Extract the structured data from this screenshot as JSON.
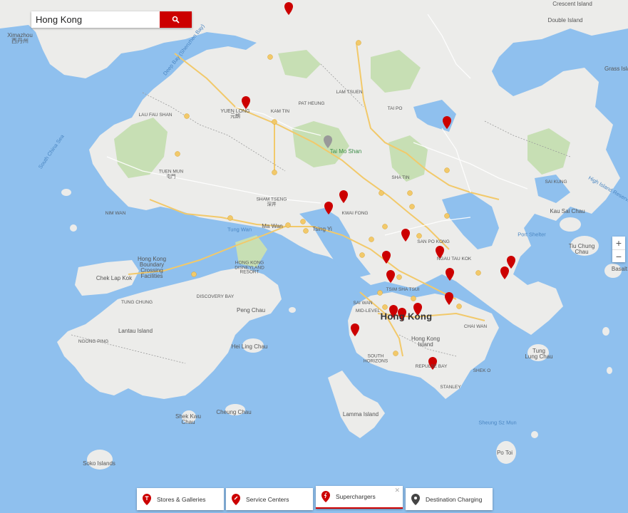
{
  "search": {
    "value": "Hong Kong"
  },
  "map": {
    "city_label": "Hong Kong",
    "labels": {
      "ximazhou": "Ximazhou\n西丹州",
      "crescent_island": "Crescent Island",
      "double_island": "Double Island",
      "grass_island": "Grass Isla",
      "yuen_long": "YUEN LONG\n元朗",
      "tai_mo_shan": "Tai Mo Shan",
      "lau_fau_shan": "LAU FAU SHAN",
      "tuen_mun": "TUEN MUN\n屯門",
      "tung_wan": "Tung Wan",
      "ma_wan": "Ma Wan",
      "tsing_yi": "Tsing Yi",
      "kwai_fong": "KWAI FONG",
      "sham_tseng": "SHAM TSENG\n深井",
      "hk_boundary": "Hong Kong\nBoundary\nCrossing\nFacilities",
      "chek_lap_kok": "Chek Lap Kok",
      "lantau_island": "Lantau Island",
      "peng_chau": "Peng Chau",
      "hei_ling_chau": "Hei Ling Chau",
      "cheung_chau": "Cheung Chau",
      "shek_kwu_chau": "Shek Kwu\nChau",
      "soko_islands": "Soko Islands",
      "lamma_island": "Lamma Island",
      "hong_kong_island": "Hong Kong\nIsland",
      "tung_lung_chau": "Tung\nLung Chau",
      "po_toi": "Po Toi",
      "kau_sai_chau": "Kau Sai Chau",
      "port_shelter": "Port Shelter",
      "tiu_chung_chau": "Tiu Chung\nChau",
      "basalt": "Basalt",
      "sai_kung": "SAI KUNG",
      "discovery_bay": "DISCOVERY BAY",
      "disneyland": "HONG KONG\nDISNEYLAND\nRESORT",
      "tung_chung": "TUNG CHUNG",
      "sheung_sz_mun": "Sheung Sz Mun",
      "south_china_sea": "South China Sea",
      "deep_bay": "Deep Bay (Shenzhen Bay)",
      "high_island": "High Island Reservoir",
      "kam_tin": "KAM TIN",
      "pat_heung": "PAT HEUNG",
      "lam_tsuen": "LAM TSUEN",
      "tai_po": "TAI PO",
      "sha_tin": "SHA TIN",
      "kowloon": "SAN PO KONG",
      "kwun_tong": "NGAU TAU KOK",
      "tsim_sha_tsui": "TSIM SHA TSUI",
      "sai_wan": "SAI WAN",
      "mid_levels": "MID-LEVEL",
      "chai_wan": "CHAI WAN",
      "repulse_bay": "REPULSE BAY",
      "stanley": "STANLEY",
      "shek_o": "SHEK O",
      "south_horizons": "SOUTH\nHORIZONS",
      "nim_wan": "NIM WAN",
      "ngong_ping": "NGONG PING"
    }
  },
  "zoom": {
    "in": "+",
    "out": "−"
  },
  "legend": [
    {
      "label": "Stores & Galleries",
      "color": "#cc0000"
    },
    {
      "label": "Service Centers",
      "color": "#cc0000"
    },
    {
      "label": "Superchargers",
      "color": "#cc0000",
      "active": true
    },
    {
      "label": "Destination Charging",
      "color": "#444444"
    }
  ],
  "colors": {
    "water": "#8fc0ee",
    "land": "#ececea",
    "park": "#c7dfb4",
    "accent": "#cc0000"
  }
}
